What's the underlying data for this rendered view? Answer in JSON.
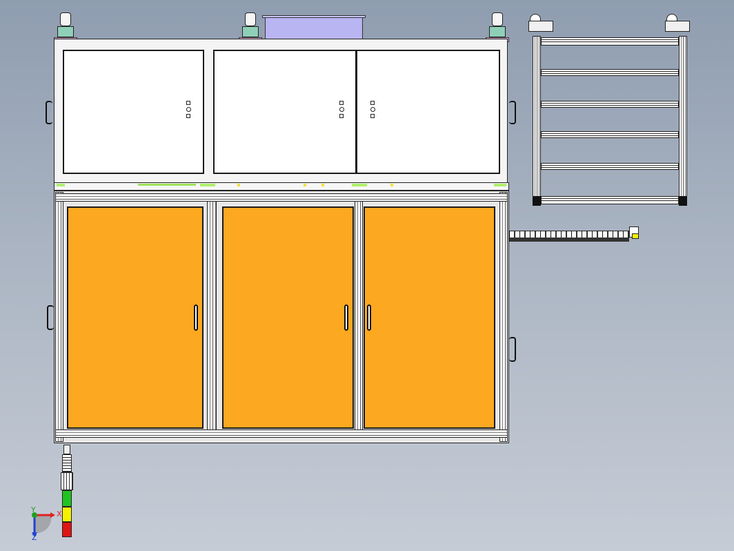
{
  "viewport": {
    "background_top": "#8f9db0",
    "background_bottom": "#c6ccd6"
  },
  "model": {
    "upper_cabinet": {
      "door_color": "#ffffff",
      "door_count": 3
    },
    "lower_cabinet": {
      "door_color": "#fca820",
      "door_count": 3
    },
    "stack_light": {
      "segments": [
        "green",
        "yellow",
        "red"
      ],
      "colors": {
        "green": "#21c321",
        "yellow": "#f5f200",
        "red": "#e01414"
      }
    }
  },
  "triad": {
    "x_label": "X",
    "y_label": "Y",
    "z_label": "Z",
    "x_color": "#e02020",
    "y_color": "#20a020",
    "z_color": "#2040d0"
  }
}
